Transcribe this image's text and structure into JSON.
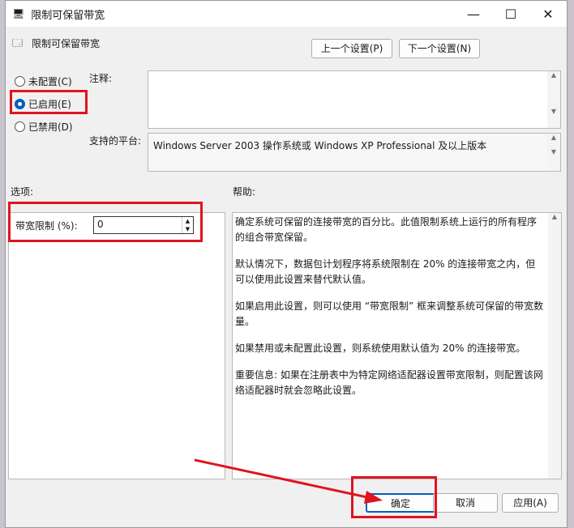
{
  "window": {
    "title": "限制可保留带宽",
    "minimize": "—",
    "maximize": "☐",
    "close": "✕"
  },
  "header": {
    "setting_name": "限制可保留带宽",
    "prev_button": "上一个设置(P)",
    "next_button": "下一个设置(N)"
  },
  "state": {
    "options": [
      {
        "label": "未配置(C)",
        "selected": false
      },
      {
        "label": "已启用(E)",
        "selected": true
      },
      {
        "label": "已禁用(D)",
        "selected": false
      }
    ]
  },
  "comment": {
    "label": "注释:",
    "value": ""
  },
  "platform": {
    "label": "支持的平台:",
    "value": "Windows Server 2003 操作系统或 Windows XP Professional 及以上版本"
  },
  "options_panel": {
    "label": "选项:",
    "bandwidth_label": "带宽限制 (%):",
    "bandwidth_value": "0"
  },
  "help_panel": {
    "label": "帮助:",
    "paragraphs": [
      "确定系统可保留的连接带宽的百分比。此值限制系统上运行的所有程序的组合带宽保留。",
      "默认情况下，数据包计划程序将系统限制在 20% 的连接带宽之内，但可以使用此设置来替代默认值。",
      "如果启用此设置，则可以使用 “带宽限制” 框来调整系统可保留的带宽数量。",
      "如果禁用或未配置此设置，则系统使用默认值为 20% 的连接带宽。",
      "重要信息: 如果在注册表中为特定网络适配器设置带宽限制，则配置该网络适配器时就会忽略此设置。"
    ]
  },
  "footer": {
    "ok": "确定",
    "cancel": "取消",
    "apply": "应用(A)"
  },
  "colors": {
    "highlight": "#e0141e",
    "accent": "#005fb8"
  }
}
